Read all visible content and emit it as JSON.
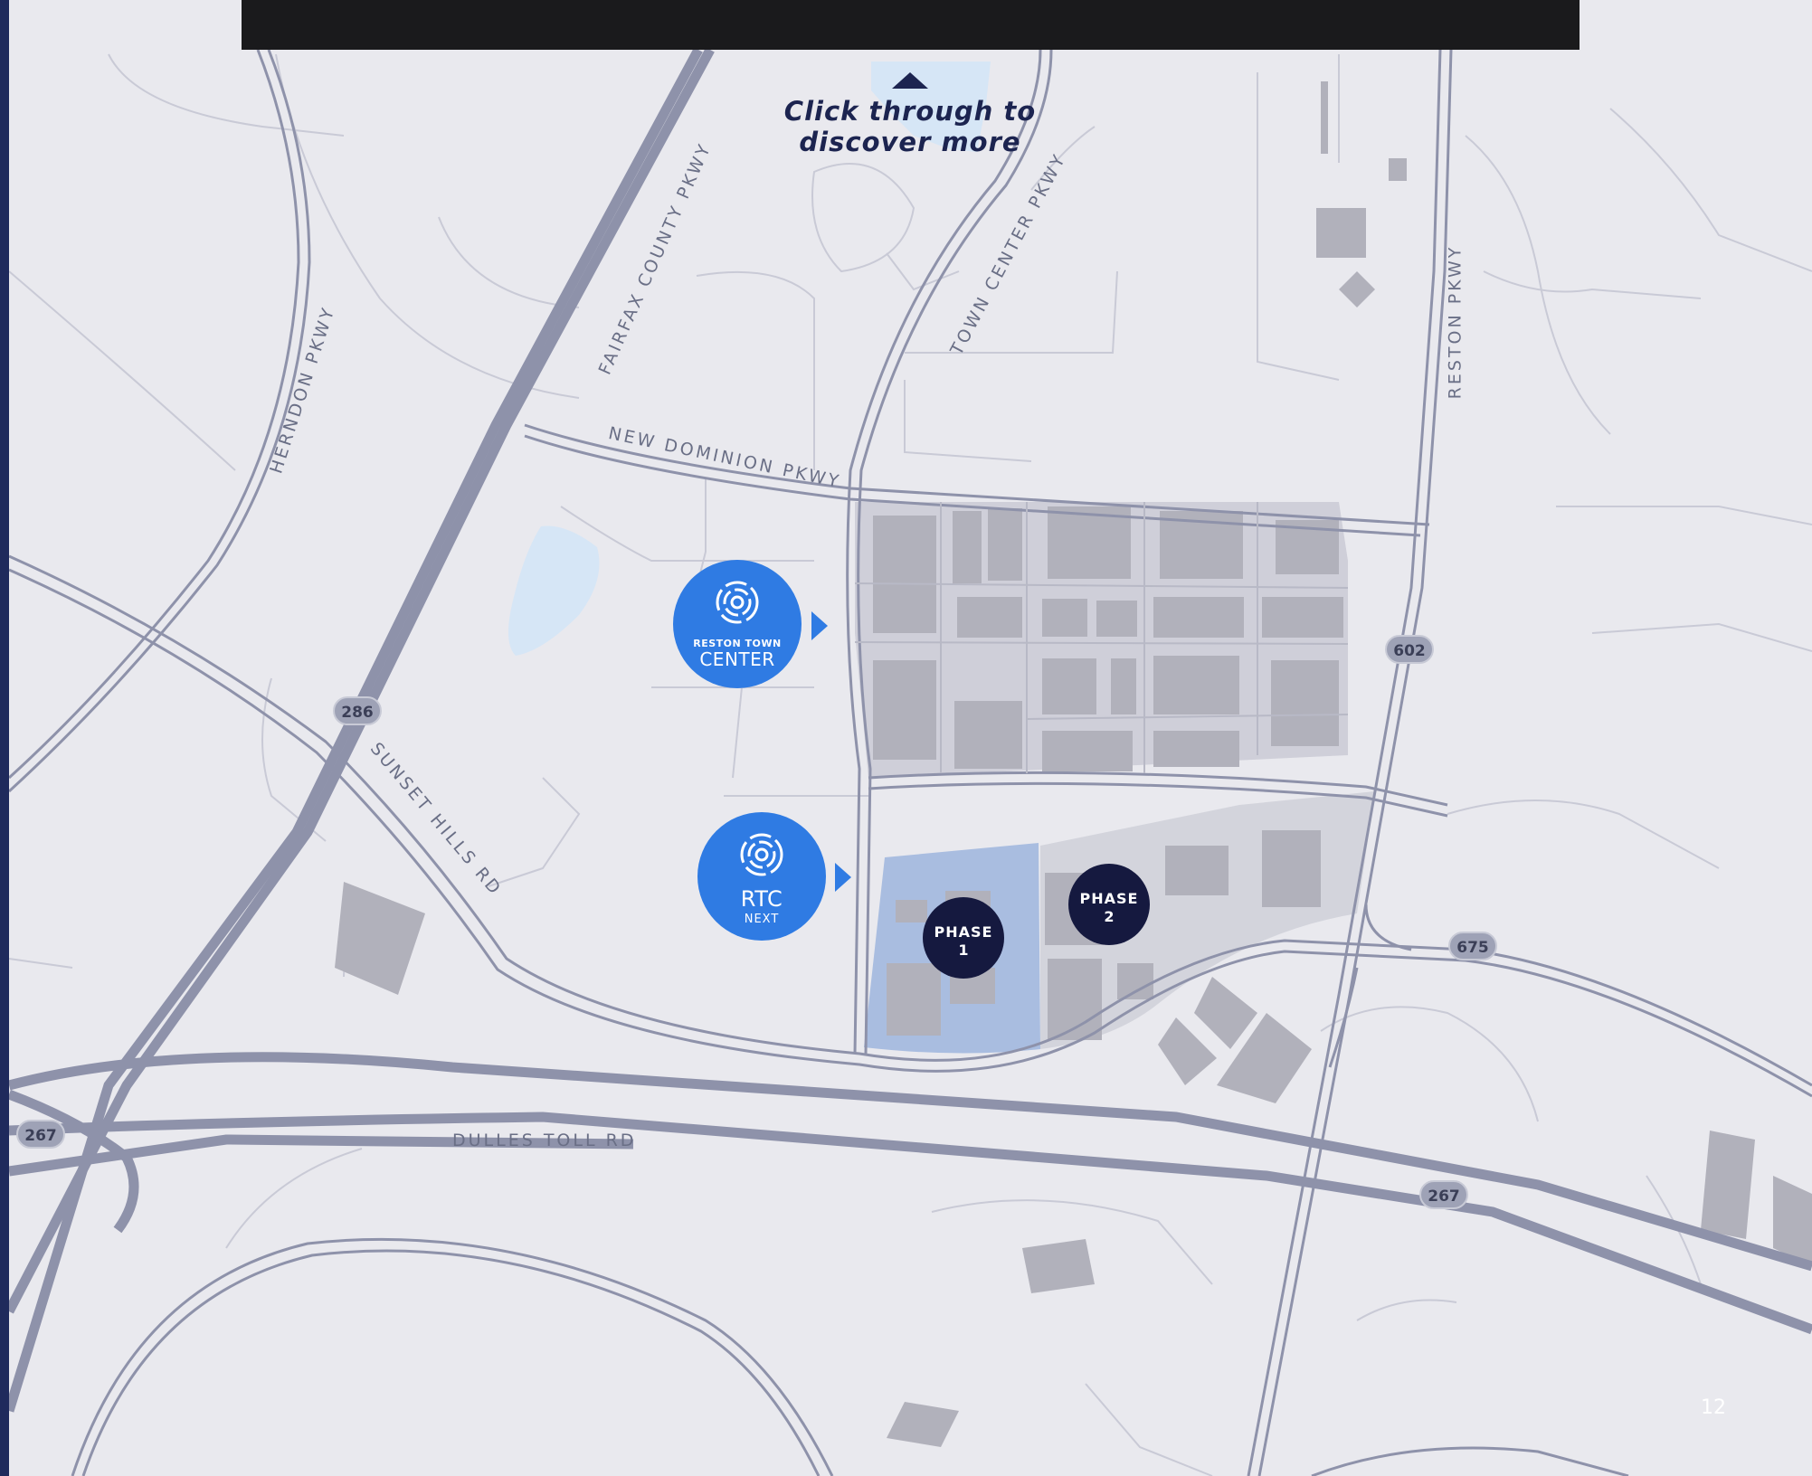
{
  "cta": {
    "text": "Click through to discover more"
  },
  "roads": {
    "herndon": "HERNDON PKWY",
    "fairfax": "FAIRFAX COUNTY PKWY",
    "town_center": "TOWN CENTER PKWY",
    "reston": "RESTON PKWY",
    "new_dominion": "NEW DOMINION PKWY",
    "sunset_hills": "SUNSET HILLS RD",
    "dulles": "DULLES TOLL RD"
  },
  "shields": [
    "286",
    "602",
    "675",
    "267",
    "267"
  ],
  "brands": {
    "rtc": {
      "line1": "RESTON TOWN",
      "line2": "CENTER"
    },
    "rtc_next": {
      "line1": "RTC",
      "line2": "NEXT"
    }
  },
  "phases": {
    "phase1": {
      "label": "PHASE",
      "number": "1"
    },
    "phase2": {
      "label": "PHASE",
      "number": "2"
    }
  },
  "page_number": "12",
  "colors": {
    "background": "#e9e9ee",
    "road": "#8e92aa",
    "brand_blue": "#2f7be3",
    "phase_navy": "#15193f",
    "highlight": "#a9bde0"
  }
}
